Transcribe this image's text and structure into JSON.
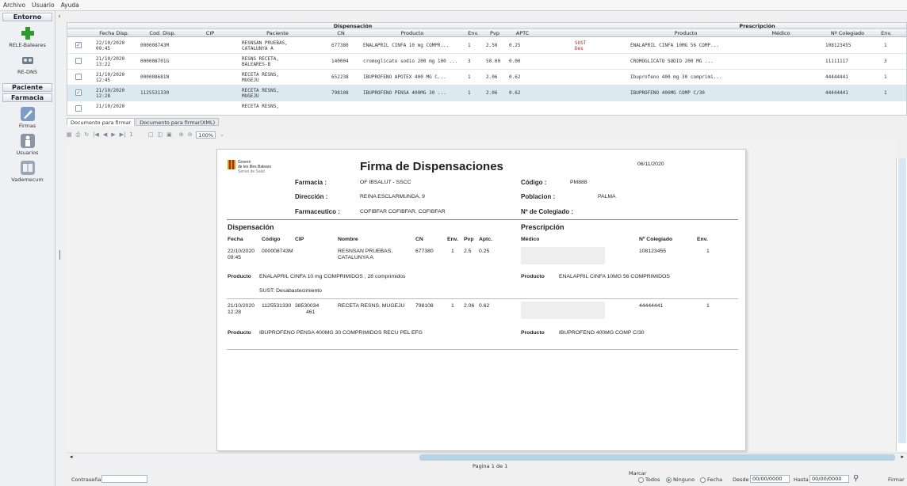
{
  "menu": [
    "Archivo",
    "Usuario",
    "Ayuda"
  ],
  "sidebar": {
    "entorno": "Entorno",
    "rele": "RELE-Baleares",
    "redns": "RE-DNS",
    "paciente": "Paciente",
    "farmacia": "Farmacia",
    "firmas": "Firmas",
    "usuarios": "Usuarios",
    "vademecum": "Vademecum"
  },
  "grid": {
    "group_disp": "Dispensación",
    "group_presc": "Prescripción",
    "columns": [
      "Fecha Disp.",
      "Cod. Disp.",
      "CIP",
      "Paciente",
      "CN",
      "Producto",
      "Env.",
      "Pvp",
      "APTC",
      "",
      "Producto",
      "Médico",
      "Nº Colegiado",
      "Env."
    ],
    "rows": [
      {
        "checked": true,
        "selected": false,
        "fecha": "22/10/2020",
        "hora": "09:45",
        "cod": "000008743M",
        "cip": "",
        "pac1": "RESNSAN PRUEBAS,",
        "pac2": "CATALUNYA A",
        "cn": "677380",
        "prod": "ENALAPRIL CINFA 10 mg COMPR...",
        "env": "1",
        "pvp": "2.50",
        "aptc": "0.25",
        "sust1": "SUST",
        "sust2": "Des",
        "pprod": "ENALAPRIL CINFA 10MG 56 COMP...",
        "med": "",
        "col": "108123455",
        "penv": "1"
      },
      {
        "checked": false,
        "selected": false,
        "fecha": "21/10/2020",
        "hora": "13:22",
        "cod": "000008701G",
        "cip": "",
        "pac1": "RESNS RECETA,",
        "pac2": "BALEARES-B",
        "cn": "140004",
        "prod": "cromoglicato sodio 200 mg 100 ...",
        "env": "3",
        "pvp": "50.00",
        "aptc": "0.00",
        "sust1": "",
        "sust2": "",
        "pprod": "CROMOGLICATO SODIO 200 MG ...",
        "med": "",
        "col": "11111117",
        "penv": "3"
      },
      {
        "checked": false,
        "selected": false,
        "fecha": "21/10/2020",
        "hora": "12:45",
        "cod": "000008681N",
        "cip": "",
        "pac1": "RECETA RESNS,",
        "pac2": "MUGEJU",
        "cn": "652238",
        "prod": "IBUPROFENO APOTEX 400 MG C...",
        "env": "1",
        "pvp": "2.06",
        "aptc": "0.62",
        "sust1": "",
        "sust2": "",
        "pprod": "Ibuprofeno 400 mg 30 comprimi...",
        "med": "",
        "col": "44444441",
        "penv": "1"
      },
      {
        "checked": true,
        "selected": true,
        "fecha": "21/10/2020",
        "hora": "12:28",
        "cod": "1125531330",
        "cip": "",
        "pac1": "RECETA RESNS,",
        "pac2": "MUGEJU",
        "cn": "798108",
        "prod": "IBUPROFENO PENSA 400MG 30 ...",
        "env": "1",
        "pvp": "2.06",
        "aptc": "0.62",
        "sust1": "",
        "sust2": "",
        "pprod": "IBUPROFENO 400MG COMP C/30",
        "med": "",
        "col": "44444441",
        "penv": "1"
      },
      {
        "checked": false,
        "selected": false,
        "fecha": "21/10/2020",
        "hora": "",
        "cod": "",
        "cip": "",
        "pac1": "RECETA RESNS,",
        "pac2": "",
        "cn": "",
        "prod": "",
        "env": "",
        "pvp": "",
        "aptc": "",
        "sust1": "",
        "sust2": "",
        "pprod": "",
        "med": "",
        "col": "",
        "penv": ""
      }
    ]
  },
  "tabs": [
    "Documento para firmar",
    "Documento para firmar(XML)"
  ],
  "toolbar": {
    "page": "1",
    "zoom": "100%"
  },
  "report": {
    "logo1": "Govern",
    "logo2": "de les Illes Balears",
    "logo3": "Servei de Salut",
    "title": "Firma de Dispensaciones",
    "date": "06/11/2020",
    "farmacia_label": "Farmacia :",
    "farmacia": "OF IBSALUT - SSCC",
    "codigo_label": "Código :",
    "codigo": "PM888",
    "direccion_label": "Dirección :",
    "direccion": "REINA ESCLARMUNDA, 9",
    "poblacion_label": "Poblacion :",
    "poblacion": "PALMA",
    "farmaceutico_label": "Farmaceutico :",
    "farmaceutico": "COFIBFAR COFIBFAR, COFIBFAR",
    "colegiado_label": "Nº de Colegiado :",
    "sec_disp": "Dispensación",
    "sec_presc": "Prescripción",
    "cols": {
      "fecha": "Fecha",
      "codigo": "Código",
      "cip": "CIP",
      "nombre": "Nombre",
      "cn": "CN",
      "env": "Env.",
      "pvp": "Pvp",
      "aptc": "Aptc.",
      "medico": "Médico",
      "colegiado": "Nº Colegiado",
      "penv": "Env."
    },
    "producto_label": "Producto",
    "items": [
      {
        "fecha1": "22/10/2020",
        "fecha2": "09:45",
        "codigo": "000008743M",
        "cip1": "",
        "cip2": "",
        "nombre1": "RESNSAN PRUEBAS,",
        "nombre2": "CATALUNYA A",
        "cn": "677380",
        "env": "1",
        "pvp": "2.5",
        "aptc": "0.25",
        "colegiado": "108123455",
        "penv": "1",
        "producto": "ENALAPRIL CINFA 10 mg COMPRIMIDOS , 28 comprimidos",
        "sust": "SUST: Desabastecimiento",
        "pproducto": "ENALAPRIL CINFA 10MG 56 COMPRIMIDOS"
      },
      {
        "fecha1": "21/10/2020",
        "fecha2": "12:28",
        "codigo": "1125531330",
        "cip1": "38530034",
        "cip2": "461",
        "nombre1": "RECETA RESNS, MUGEJU",
        "nombre2": "",
        "cn": "798108",
        "env": "1",
        "pvp": "2.06",
        "aptc": "0.62",
        "colegiado": "44444441",
        "penv": "1",
        "producto": "IBUPROFENO PENSA 400MG 30 COMPRIMIDOS RECU PEL EFG",
        "sust": "",
        "pproducto": "IBUPROFENO 400MG COMP C/30"
      }
    ]
  },
  "footer": {
    "pagina": "Pagina 1 de 1",
    "contrasena": "Contraseña",
    "marcar": "Marcar",
    "todos": "Todos",
    "ninguno": "Ninguno",
    "fecha": "Fecha",
    "desde": "Desde",
    "desde_val": "00/00/0000",
    "hasta": "Hasta",
    "hasta_val": "00/00/0000",
    "firmar": "Firmar"
  },
  "colors": {
    "selected_row": "#dbe9f1",
    "sust": "#d02020",
    "accent": "#2b6aa8"
  }
}
